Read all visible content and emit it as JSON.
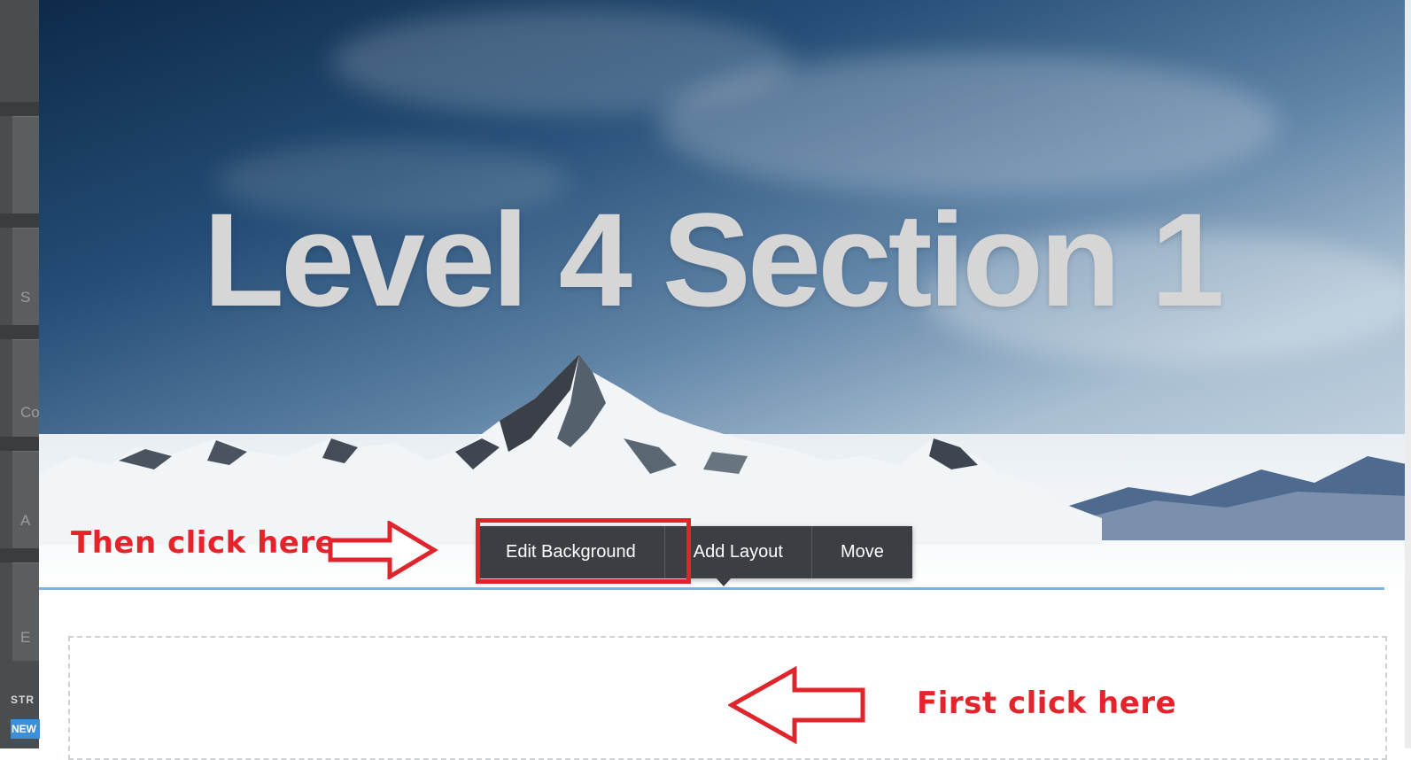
{
  "sidebar": {
    "visible_letters": [
      "S",
      "Co",
      "A",
      "E"
    ],
    "section_label": "STR",
    "badge": "NEW"
  },
  "hero": {
    "title": "Level 4 Section 1"
  },
  "toolbar": {
    "edit_background": "Edit Background",
    "add_layout": "Add Layout",
    "move": "Move"
  },
  "annotations": {
    "then_click": "Then click here",
    "first_click": "First click here"
  },
  "colors": {
    "annotation_red": "#e0242b",
    "toolbar_bg": "#3b3f43",
    "accent_blue": "#7fb3e3"
  }
}
